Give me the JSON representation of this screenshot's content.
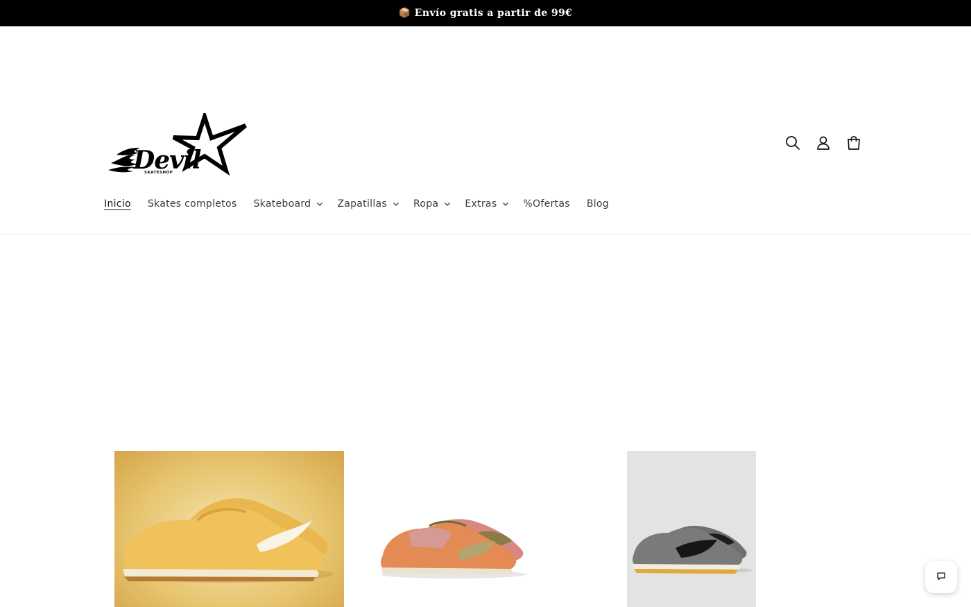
{
  "announcement": {
    "text": "📦 Envío gratis a partir de 99€",
    "icon": "box-icon"
  },
  "header": {
    "logo_text": "Devil",
    "logo_subtext": "SKATESHOP",
    "icons": [
      "search-icon",
      "account-icon",
      "cart-icon"
    ]
  },
  "nav": {
    "items": [
      {
        "label": "Inicio",
        "dropdown": false,
        "active": true
      },
      {
        "label": "Skates completos",
        "dropdown": false
      },
      {
        "label": "Skateboard",
        "dropdown": true
      },
      {
        "label": "Zapatillas",
        "dropdown": true
      },
      {
        "label": "Ropa",
        "dropdown": true
      },
      {
        "label": "Extras",
        "dropdown": true
      },
      {
        "label": "%Ofertas",
        "dropdown": false
      },
      {
        "label": "Blog",
        "dropdown": false
      }
    ]
  },
  "products": [
    {
      "image": "yellow-sneaker",
      "colors": [
        "#e8b95a",
        "#f1ece0"
      ]
    },
    {
      "image": "pink-orange-sneaker",
      "colors": [
        "#d98a7c",
        "#e07a3c"
      ]
    },
    {
      "image": "grey-black-sneaker",
      "colors": [
        "#6f6f6f",
        "#1c1c1c"
      ]
    }
  ],
  "chat": {
    "icon": "chat-icon"
  },
  "colors": {
    "announcement_bg": "#000000",
    "accent": "#121212"
  }
}
